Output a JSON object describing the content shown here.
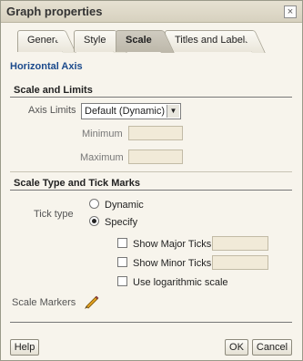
{
  "dialog": {
    "title": "Graph properties",
    "close_glyph": "×"
  },
  "tabs": [
    {
      "label": "General"
    },
    {
      "label": "Style"
    },
    {
      "label": "Scale"
    },
    {
      "label": "Titles and Labels"
    }
  ],
  "active_tab": "Scale",
  "axis_heading": "Horizontal Axis",
  "scale_limits": {
    "title": "Scale and Limits",
    "axis_limits_label": "Axis Limits",
    "axis_limits_value": "Default (Dynamic)",
    "minimum_label": "Minimum",
    "minimum_value": "",
    "maximum_label": "Maximum",
    "maximum_value": ""
  },
  "tick_marks": {
    "title": "Scale Type and Tick Marks",
    "tick_type_label": "Tick type",
    "options": [
      "Dynamic",
      "Specify"
    ],
    "selected": "Specify",
    "show_major_label": "Show Major Ticks",
    "show_major_checked": false,
    "show_minor_label": "Show Minor Ticks",
    "show_minor_checked": false,
    "log_scale_label": "Use logarithmic scale",
    "log_scale_checked": false
  },
  "scale_markers_label": "Scale Markers",
  "scale_markers_icon": "pencil-icon",
  "footer": {
    "help_label": "Help",
    "ok_label": "OK",
    "cancel_label": "Cancel"
  }
}
